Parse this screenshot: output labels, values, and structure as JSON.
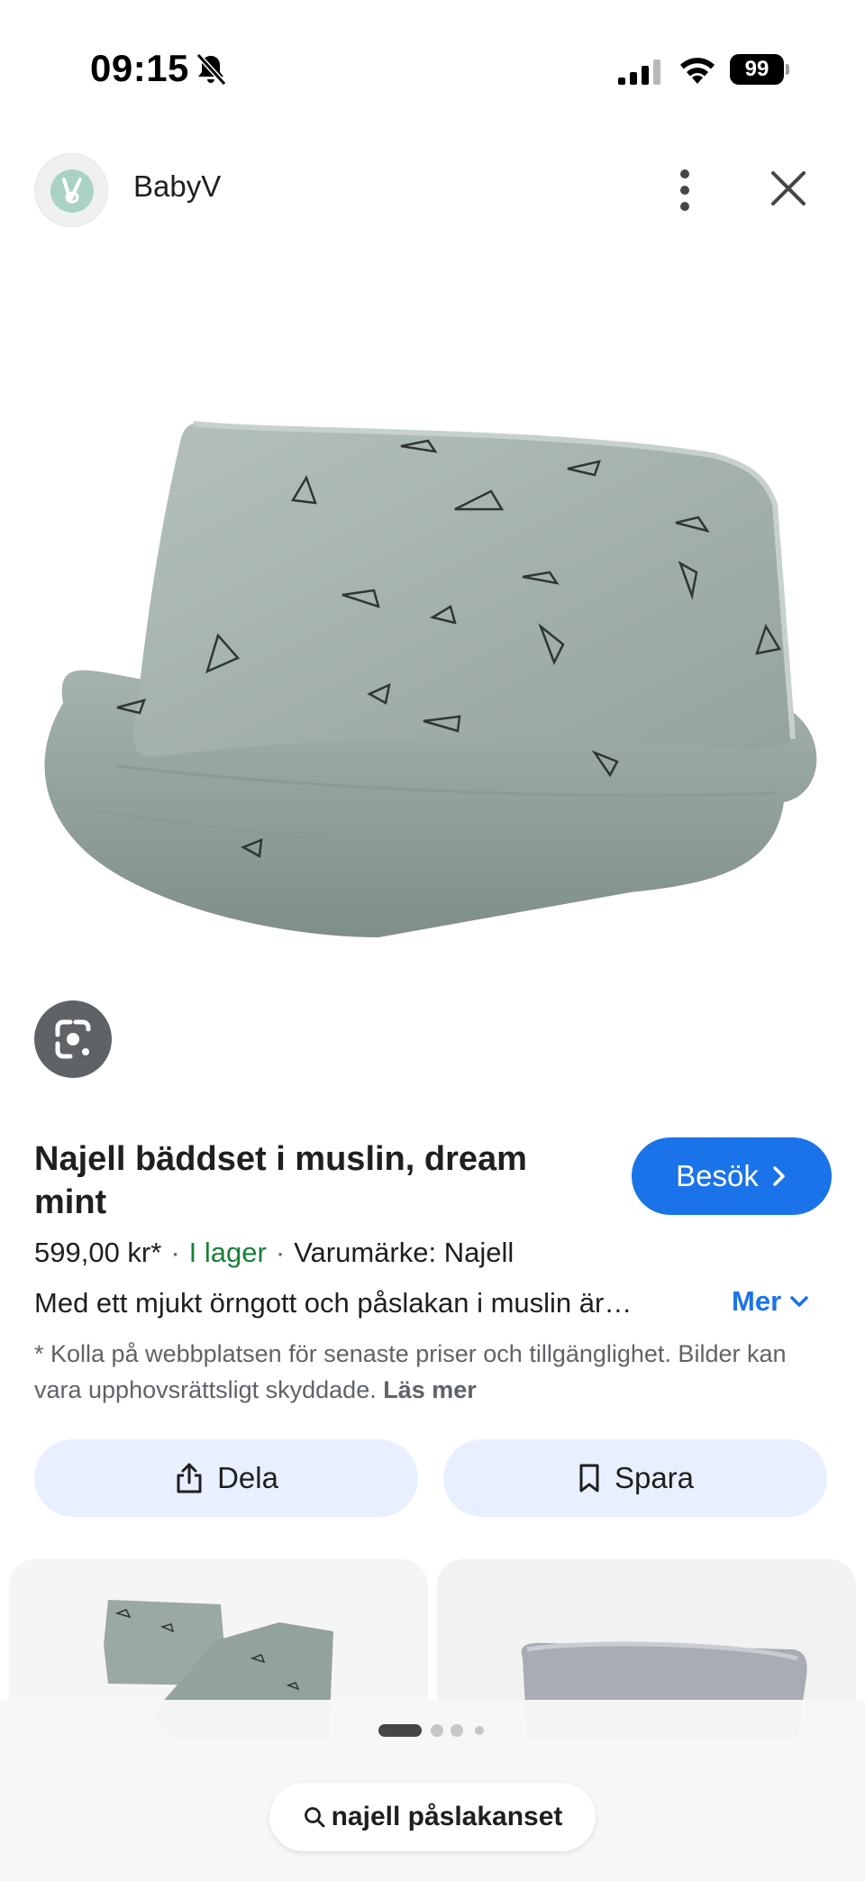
{
  "status_bar": {
    "time": "09:15",
    "battery": "99"
  },
  "header": {
    "source_name": "BabyV"
  },
  "product": {
    "title": "Najell bäddset i muslin, dream mint",
    "price": "599,00 kr*",
    "separator": "·",
    "stock": "I lager",
    "brand": "Varumärke: Najell",
    "description": "Med ett mjukt örngott och påslakan i muslin är…",
    "more_label": "Mer",
    "visit_label": "Besök",
    "disclaimer": "* Kolla på webbplatsen för senaste priser och tillgänglighet. Bilder kan vara upphovsrättsligt skyddade.",
    "read_more_label": "Läs mer"
  },
  "actions": {
    "share_label": "Dela",
    "save_label": "Spara"
  },
  "search": {
    "query": "najell påslakanset"
  },
  "colors": {
    "accent": "#1a73e8",
    "stock_green": "#188038",
    "action_bg": "#e8efff",
    "fabric_mint": "#9aaaa3"
  },
  "icons": {
    "status": [
      "bell-off-icon",
      "signal-icon",
      "wifi-icon",
      "battery-icon"
    ],
    "header": [
      "more-vert-icon",
      "close-icon"
    ],
    "lens": "google-lens-icon",
    "share": "share-icon",
    "save": "bookmark-icon",
    "search": "search-icon"
  }
}
